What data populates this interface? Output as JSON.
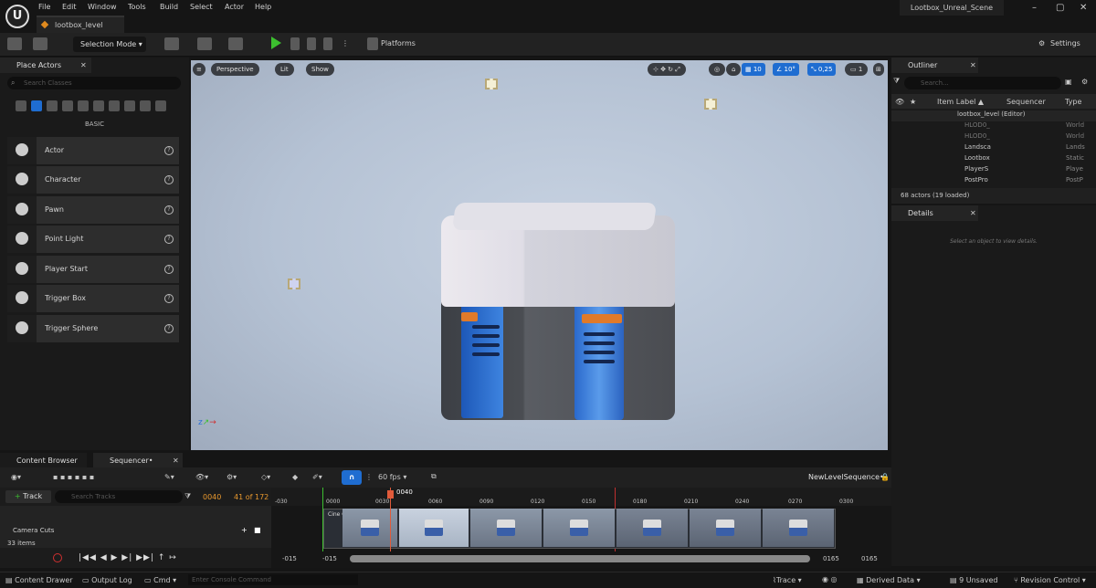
{
  "menu": [
    "File",
    "Edit",
    "Window",
    "Tools",
    "Build",
    "Select",
    "Actor",
    "Help"
  ],
  "level_tab": "lootbox_level",
  "scene_tab": "Lootbox_Unreal_Scene",
  "toolbar": {
    "selection_mode": "Selection Mode",
    "platforms": "Platforms",
    "settings": "Settings"
  },
  "place_actors": {
    "title": "Place Actors",
    "search_placeholder": "Search Classes",
    "category": "BASIC",
    "items": [
      "Actor",
      "Character",
      "Pawn",
      "Point Light",
      "Player Start",
      "Trigger Box",
      "Trigger Sphere"
    ]
  },
  "viewport": {
    "perspective": "Perspective",
    "lit": "Lit",
    "show": "Show",
    "grid": "10",
    "angle": "10°",
    "scale": "0,25",
    "camera": "1"
  },
  "outliner": {
    "title": "Outliner",
    "search_placeholder": "Search...",
    "col_label": "Item Label ▲",
    "col_sequencer": "Sequencer",
    "col_type": "Type",
    "rows": [
      {
        "label": "lootbox_level (Editor)",
        "type": ""
      },
      {
        "label": "HLOD0_",
        "type": "World"
      },
      {
        "label": "HLOD0_",
        "type": "World"
      },
      {
        "label": "Landsca",
        "type": "Lands"
      },
      {
        "label": "Lootbox",
        "type": "Static"
      },
      {
        "label": "PlayerS",
        "type": "Playe"
      },
      {
        "label": "PostPro",
        "type": "PostP"
      }
    ],
    "count": "68 actors (19 loaded)"
  },
  "details": {
    "title": "Details",
    "empty": "Select an object to view details."
  },
  "bottom_tabs": {
    "content_browser": "Content Browser",
    "sequencer": "Sequencer•"
  },
  "sequencer": {
    "fps": "60 fps",
    "sequence_name": "NewLevelSequence•",
    "add_track": "+ Track",
    "search_placeholder": "Search Tracks",
    "current_frame": "0040",
    "frame_count": "41 of 172",
    "playhead": "0040",
    "ticks": [
      "-030",
      "0000",
      "0030",
      "0060",
      "0090",
      "0120",
      "0150",
      "0180",
      "0210",
      "0240",
      "0270",
      "0300"
    ],
    "track": "Camera Cuts",
    "clip": "Cine Camera Actor",
    "items": "33 items",
    "range_start": "-015",
    "range_start2": "-015",
    "range_end": "0165",
    "range_end2": "0165"
  },
  "status": {
    "content_drawer": "Content Drawer",
    "output_log": "Output Log",
    "cmd": "Cmd",
    "console_placeholder": "Enter Console Command",
    "trace": "Trace",
    "derived": "Derived Data",
    "unsaved": "9 Unsaved",
    "revision": "Revision Control"
  }
}
